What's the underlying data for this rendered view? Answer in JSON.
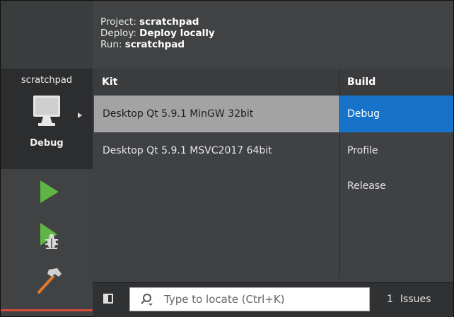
{
  "project_info": {
    "project_label": "Project:",
    "project_value": "scratchpad",
    "deploy_label": "Deploy:",
    "deploy_value": "Deploy locally",
    "run_label": "Run:",
    "run_value": "scratchpad"
  },
  "target_selector": {
    "project_name": "scratchpad",
    "configuration": "Debug",
    "icons": [
      "monitor-icon",
      "chevron-right-icon"
    ]
  },
  "mode_actions": {
    "icons": [
      "run-icon",
      "debug-run-icon",
      "build-hammer-icon"
    ]
  },
  "columns": {
    "kit": "Kit",
    "build": "Build"
  },
  "kits": [
    {
      "label": "Desktop Qt 5.9.1 MinGW 32bit",
      "selected": true
    },
    {
      "label": "Desktop Qt 5.9.1 MSVC2017 64bit",
      "selected": false
    }
  ],
  "builds": [
    {
      "label": "Debug",
      "selected": true
    },
    {
      "label": "Profile",
      "selected": false
    },
    {
      "label": "Release",
      "selected": false
    }
  ],
  "bottom_bar": {
    "locator_placeholder": "Type to locate (Ctrl+K)",
    "issues_count": "1",
    "issues_label": "Issues",
    "icons": [
      "panel-toggle-icon",
      "search-icon"
    ]
  },
  "colors": {
    "selection_blue": "#1673c9",
    "selection_gray": "#a3a3a3",
    "run_green": "#5fb543",
    "accent_red": "#d84a3a"
  }
}
